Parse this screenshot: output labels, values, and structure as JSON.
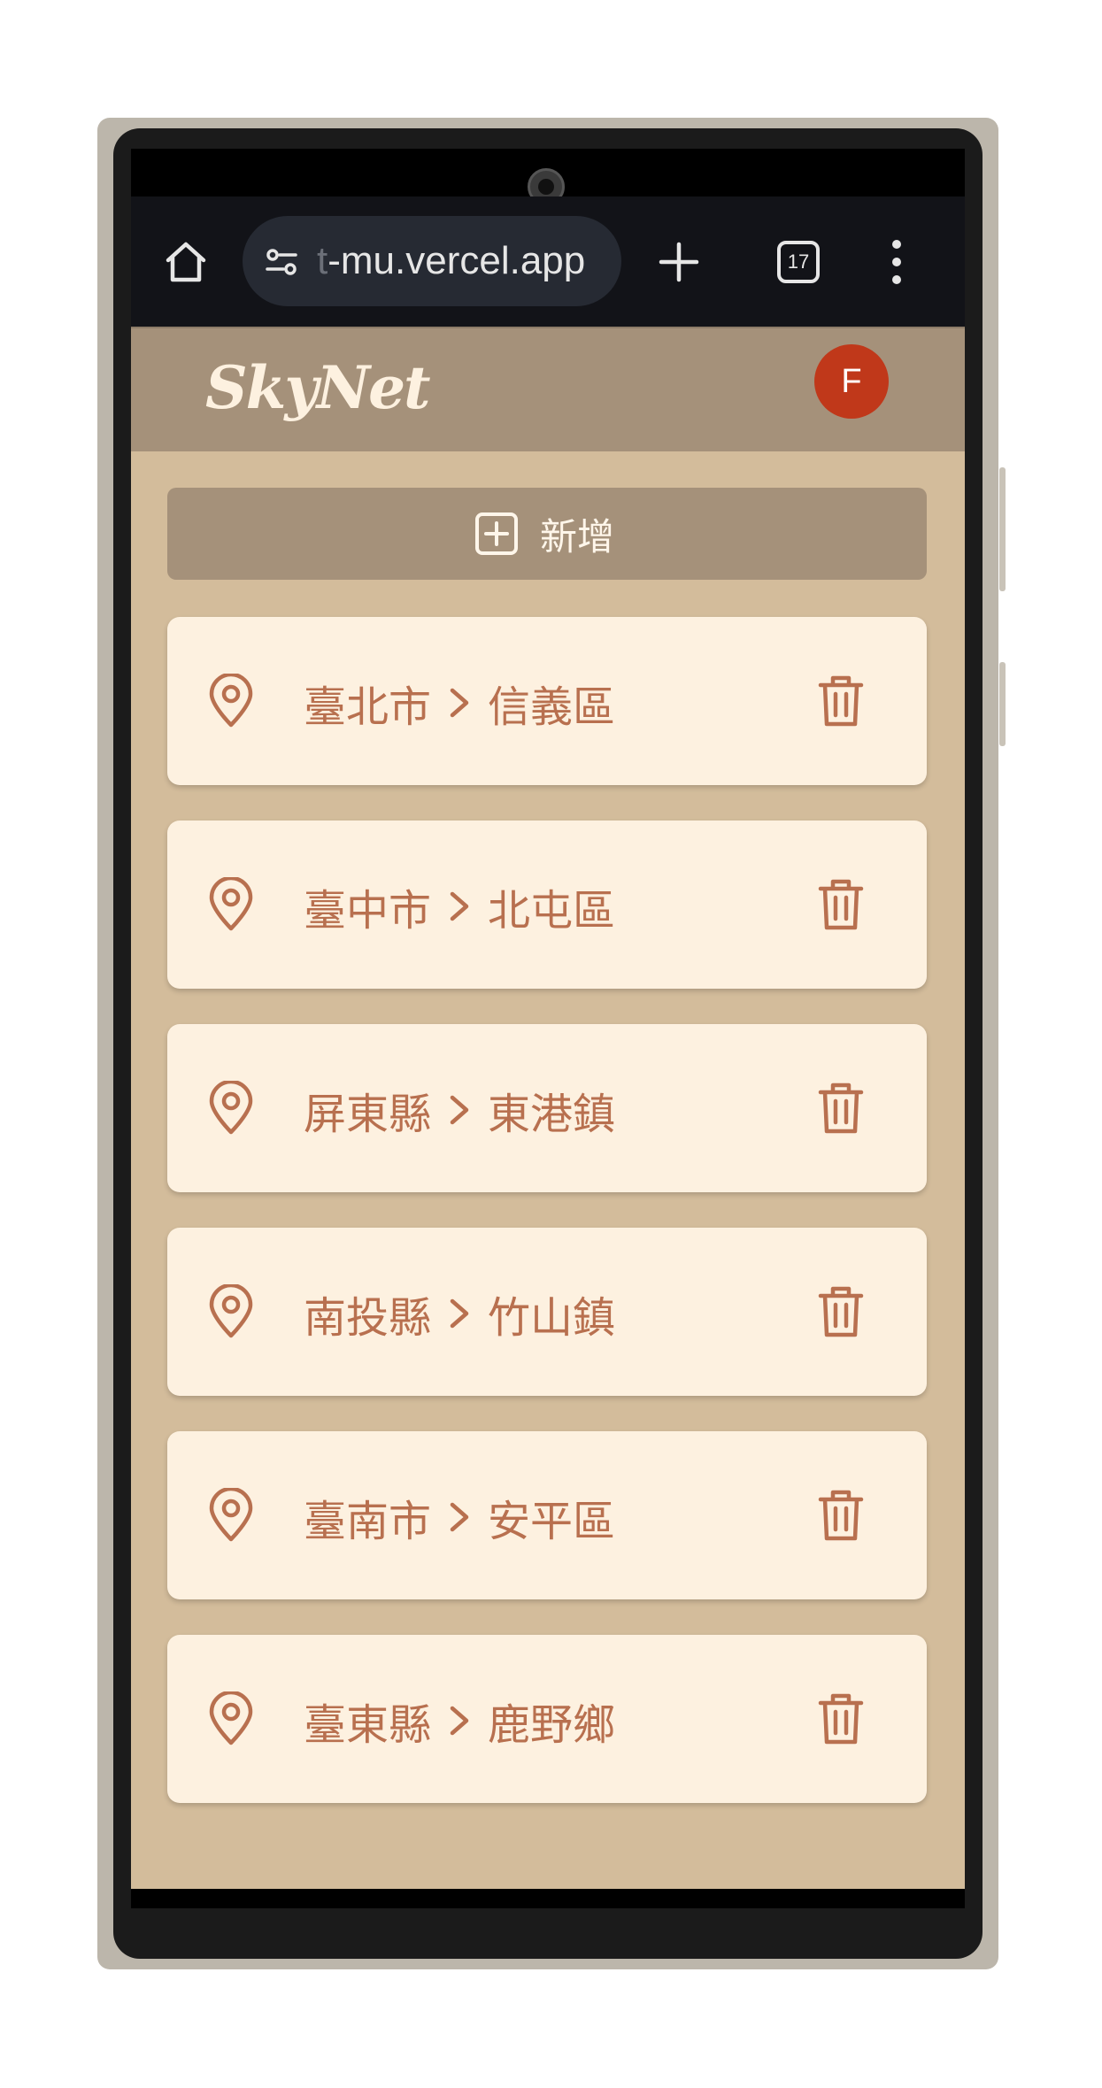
{
  "browser": {
    "url_faded": "t",
    "url_main": "-mu.vercel.app",
    "tab_count": "17"
  },
  "app": {
    "logo": "SkyNet",
    "avatar_letter": "F",
    "add_label": "新增"
  },
  "locations": [
    {
      "city": "臺北市",
      "district": "信義區"
    },
    {
      "city": "臺中市",
      "district": "北屯區"
    },
    {
      "city": "屏東縣",
      "district": "東港鎮"
    },
    {
      "city": "南投縣",
      "district": "竹山鎮"
    },
    {
      "city": "臺南市",
      "district": "安平區"
    },
    {
      "city": "臺東縣",
      "district": "鹿野鄉"
    }
  ],
  "colors": {
    "header": "#a5917a",
    "background": "#d3bc9b",
    "card": "#fdf1e0",
    "accent": "#b8704f",
    "avatar": "#c0381a"
  }
}
